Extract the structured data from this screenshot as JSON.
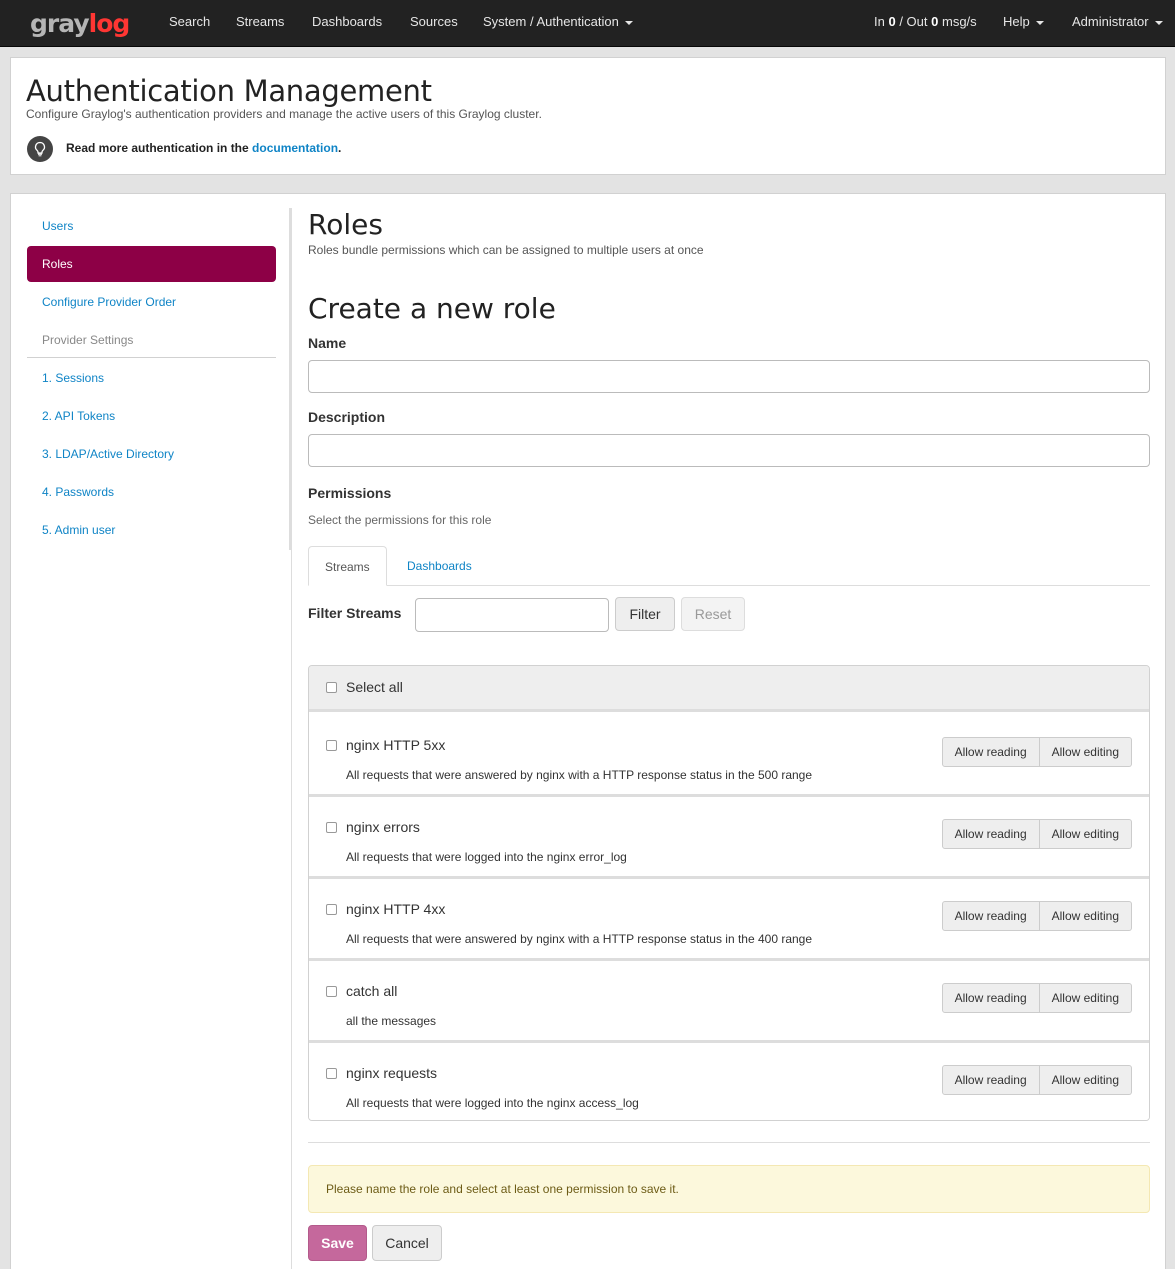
{
  "navbar": {
    "logo_part1": "gray",
    "logo_part2": "log",
    "items": [
      "Search",
      "Streams",
      "Dashboards",
      "Sources"
    ],
    "system_menu": "System / Authentication",
    "throughput": {
      "in_label": "In",
      "in_value": "0",
      "sep": "/ Out",
      "out_value": "0",
      "unit": "msg/s"
    },
    "help": "Help",
    "user": "Administrator"
  },
  "header": {
    "title": "Authentication Management",
    "subtitle": "Configure Graylog's authentication providers and manage the active users of this Graylog cluster.",
    "note_prefix": "Read more authentication in the",
    "note_link": "documentation",
    "note_suffix": ".",
    "note_icon": "lightbulb-icon"
  },
  "sidebar": {
    "items": [
      {
        "label": "Users"
      },
      {
        "label": "Roles",
        "active": true
      },
      {
        "label": "Configure Provider Order"
      }
    ],
    "section_header": "Provider Settings",
    "provider_items": [
      {
        "label": "1. Sessions"
      },
      {
        "label": "2. API Tokens"
      },
      {
        "label": "3. LDAP/Active Directory"
      },
      {
        "label": "4. Passwords"
      },
      {
        "label": "5. Admin user"
      }
    ]
  },
  "roles": {
    "title": "Roles",
    "description": "Roles bundle permissions which can be assigned to multiple users at once"
  },
  "form": {
    "title": "Create a new role",
    "name_label": "Name",
    "name_value": "",
    "description_label": "Description",
    "description_value": "",
    "permissions_label": "Permissions",
    "permissions_help": "Select the permissions for this role",
    "tabs": [
      "Streams",
      "Dashboards"
    ],
    "active_tab": "Streams",
    "filter_label": "Filter Streams",
    "filter_value": "",
    "filter_button": "Filter",
    "reset_button": "Reset",
    "select_all": "Select all",
    "streams": [
      {
        "title": "nginx HTTP 5xx",
        "description": "All requests that were answered by nginx with a HTTP response status in the 500 range"
      },
      {
        "title": "nginx errors",
        "description": "All requests that were logged into the nginx error_log"
      },
      {
        "title": "nginx HTTP 4xx",
        "description": "All requests that were answered by nginx with a HTTP response status in the 400 range"
      },
      {
        "title": "catch all",
        "description": "all the messages"
      },
      {
        "title": "nginx requests",
        "description": "All requests that were logged into the nginx access_log"
      }
    ],
    "allow_reading": "Allow reading",
    "allow_editing": "Allow editing",
    "alert": "Please name the role and select at least one permission to save it.",
    "save_button": "Save",
    "cancel_button": "Cancel"
  },
  "colors": {
    "navbar_bg": "#222222",
    "accent_active": "#8d0046",
    "link": "#0f84c6",
    "save_button": "#c5689c",
    "alert_bg": "#fcf8dc"
  }
}
